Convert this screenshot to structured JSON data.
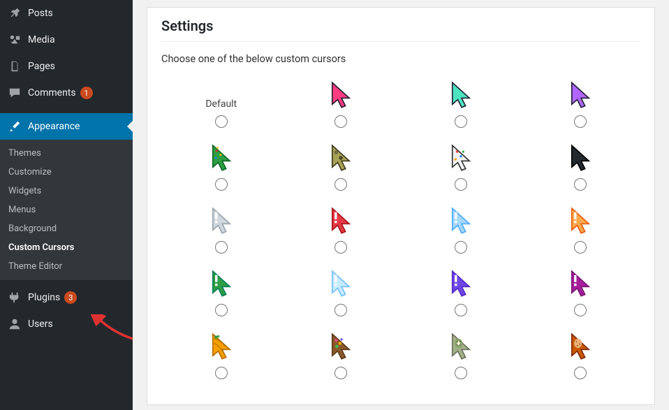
{
  "sidebar": {
    "posts": "Posts",
    "media": "Media",
    "pages": "Pages",
    "comments": "Comments",
    "comments_badge": "1",
    "appearance": "Appearance",
    "plugins": "Plugins",
    "plugins_badge": "3",
    "users": "Users",
    "submenu": {
      "themes": "Themes",
      "customize": "Customize",
      "widgets": "Widgets",
      "menus": "Menus",
      "background": "Background",
      "custom_cursors": "Custom Cursors",
      "theme_editor": "Theme Editor"
    }
  },
  "settings": {
    "title": "Settings",
    "description": "Choose one of the below custom cursors",
    "default_label": "Default"
  },
  "cursors": [
    {
      "id": "default",
      "default": true
    },
    {
      "id": "pixel-red",
      "fill": "#ff3b81",
      "stroke": "#223"
    },
    {
      "id": "pixel-teal",
      "fill": "#4de3c1",
      "stroke": "#223"
    },
    {
      "id": "pixel-purple",
      "fill": "#b066ff",
      "stroke": "#223"
    },
    {
      "id": "tree",
      "fill": "#2f9e44",
      "stroke": "#0b6623",
      "decor": "tree"
    },
    {
      "id": "camo",
      "fill": "#a8a257",
      "stroke": "#3d3a1a",
      "decor": "camo"
    },
    {
      "id": "confetti",
      "fill": "#f1f3f5",
      "stroke": "#333",
      "decor": "confetti"
    },
    {
      "id": "dark",
      "fill": "#24292e",
      "stroke": "#000"
    },
    {
      "id": "gray-excl",
      "fill": "#d0d7de",
      "stroke": "#9aa4ad",
      "excl": true
    },
    {
      "id": "red-excl",
      "fill": "#e63946",
      "stroke": "#a4161a",
      "excl": true
    },
    {
      "id": "lightblue-excl",
      "fill": "#a5d8ff",
      "stroke": "#4dabf7",
      "excl": true
    },
    {
      "id": "orange-excl",
      "fill": "#ffa94d",
      "stroke": "#e8590c",
      "excl": true
    },
    {
      "id": "green-excl",
      "fill": "#2f9e44",
      "stroke": "#087f5b",
      "excl": true
    },
    {
      "id": "paleblue-excl",
      "fill": "#c5ebff",
      "stroke": "#74c0fc",
      "excl": true
    },
    {
      "id": "violet-excl",
      "fill": "#7048e8",
      "stroke": "#5028c6",
      "excl": true
    },
    {
      "id": "magenta-excl",
      "fill": "#a61e9b",
      "stroke": "#7a1576",
      "excl": true
    },
    {
      "id": "wood-orange",
      "fill": "#f59f00",
      "stroke": "#b86e00",
      "decor": "wood"
    },
    {
      "id": "fruit",
      "fill": "#8b5a2b",
      "stroke": "#5c3a1a",
      "decor": "fruit"
    },
    {
      "id": "kiwi",
      "fill": "#a3b18a",
      "stroke": "#6b705c",
      "decor": "kiwi"
    },
    {
      "id": "toast",
      "fill": "#cc5803",
      "stroke": "#7f2a0a",
      "decor": "toast"
    }
  ]
}
